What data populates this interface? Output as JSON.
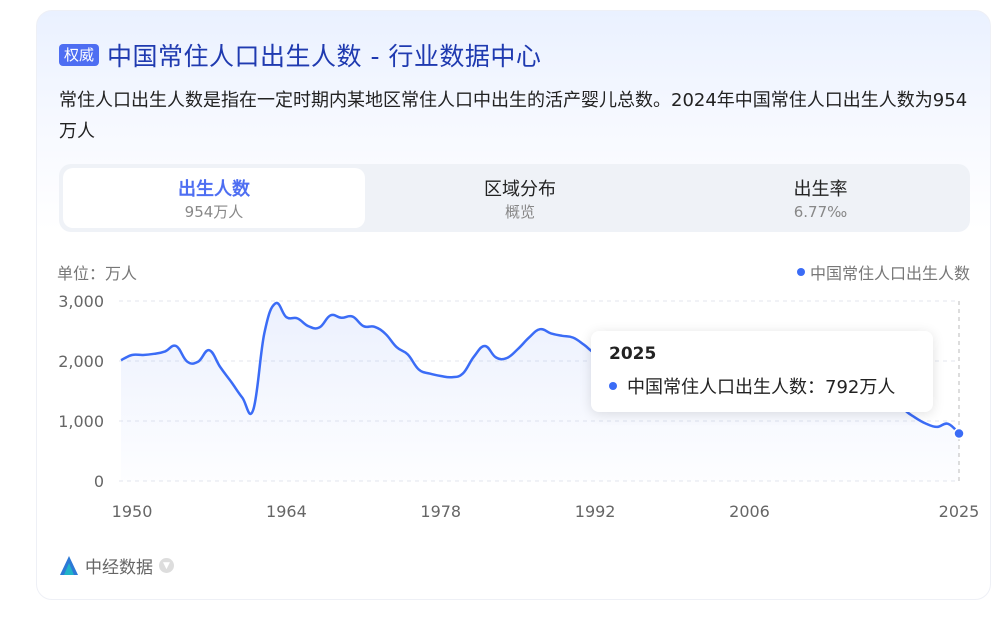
{
  "header": {
    "badge": "权威",
    "title": "中国常住人口出生人数 - 行业数据中心"
  },
  "description": "常住人口出生人数是指在一定时期内某地区常住人口中出生的活产婴儿总数。2024年中国常住人口出生人数为954万人",
  "tabs": [
    {
      "label": "出生人数",
      "sub": "954万人",
      "active": true
    },
    {
      "label": "区域分布",
      "sub": "概览",
      "active": false
    },
    {
      "label": "出生率",
      "sub": "6.77‰",
      "active": false
    }
  ],
  "unit_label": "单位：万人",
  "legend_label": "中国常住人口出生人数",
  "tooltip": {
    "title": "2025",
    "series_label": "中国常住人口出生人数：792万人"
  },
  "footer": {
    "source": "中经数据",
    "logo_icon": "zhongjing-logo-icon",
    "arrow_icon": "chevron-down-icon"
  },
  "colors": {
    "accent": "#4e6ef2",
    "line": "#3b6cf6",
    "title": "#1f3ab0"
  },
  "chart_data": {
    "type": "area",
    "series": [
      {
        "name": "中国常住人口出生人数",
        "x": [
          1949,
          1950,
          1951,
          1952,
          1953,
          1954,
          1955,
          1956,
          1957,
          1958,
          1959,
          1960,
          1961,
          1962,
          1963,
          1964,
          1965,
          1966,
          1967,
          1968,
          1969,
          1970,
          1971,
          1972,
          1973,
          1974,
          1975,
          1976,
          1977,
          1978,
          1979,
          1980,
          1981,
          1982,
          1983,
          1984,
          1985,
          1986,
          1987,
          1988,
          1989,
          1990,
          1991,
          1992,
          1993,
          1994,
          1995,
          1996,
          1997,
          1998,
          1999,
          2000,
          2001,
          2002,
          2003,
          2004,
          2005,
          2006,
          2007,
          2008,
          2009,
          2010,
          2011,
          2012,
          2013,
          2014,
          2015,
          2016,
          2017,
          2018,
          2019,
          2020,
          2021,
          2022,
          2023,
          2024,
          2025
        ],
        "values": [
          2013,
          2100,
          2100,
          2120,
          2160,
          2250,
          1990,
          1990,
          2180,
          1900,
          1650,
          1390,
          1190,
          2460,
          2960,
          2730,
          2710,
          2580,
          2560,
          2760,
          2720,
          2740,
          2580,
          2570,
          2450,
          2230,
          2110,
          1860,
          1790,
          1750,
          1730,
          1790,
          2070,
          2250,
          2060,
          2050,
          2200,
          2390,
          2530,
          2460,
          2420,
          2390,
          2270,
          2130,
          2130,
          2110,
          2070,
          2070,
          2040,
          1990,
          1940,
          1780,
          1700,
          1650,
          1600,
          1600,
          1620,
          1590,
          1600,
          1610,
          1620,
          1600,
          1610,
          1640,
          1640,
          1690,
          1660,
          1790,
          1740,
          1520,
          1470,
          1200,
          1060,
          956,
          902,
          954,
          792
        ]
      }
    ],
    "x_ticks": [
      "1950",
      "1964",
      "1978",
      "1992",
      "2006",
      "2025"
    ],
    "y_ticks": [
      "0",
      "1,000",
      "2,000",
      "3,000"
    ],
    "ylim": [
      0,
      3000
    ],
    "xlim": [
      1949,
      2025
    ],
    "highlight_x": 2025,
    "grid": true,
    "legend_position": "top-right"
  }
}
